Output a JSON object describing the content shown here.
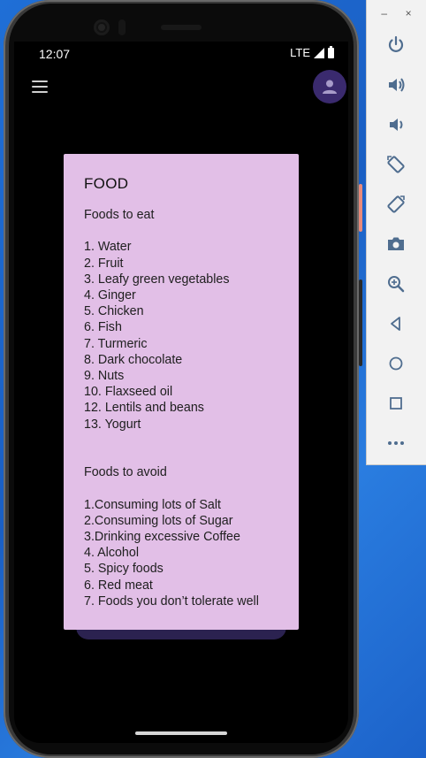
{
  "status_bar": {
    "time": "12:07",
    "network": "LTE"
  },
  "note": {
    "title": "FOOD",
    "lines": [
      "Foods to eat",
      "",
      "1. Water",
      "2. Fruit",
      "3. Leafy green vegetables",
      "4. Ginger",
      "5. Chicken",
      "6. Fish",
      "7. Turmeric",
      "8. Dark chocolate",
      "9. Nuts",
      "10. Flaxseed oil",
      "12. Lentils and beans",
      "13. Yogurt",
      "",
      "",
      "Foods to avoid",
      "",
      "1.Consuming lots of Salt",
      "2.Consuming lots of Sugar",
      "3.Drinking excessive Coffee",
      "4. Alcohol",
      "5. Spicy foods",
      "6. Red meat",
      "7. Foods you don’t tolerate well"
    ]
  },
  "emulator_toolbar": {
    "window_controls": [
      "–",
      "×"
    ],
    "buttons": [
      "power-icon",
      "volume-up-icon",
      "volume-down-icon",
      "rotate-left-icon",
      "rotate-right-icon",
      "camera-icon",
      "zoom-icon",
      "back-icon",
      "home-icon",
      "overview-icon",
      "more-icon"
    ]
  },
  "colors": {
    "card": "#e2bfe7",
    "avatar": "#3a2a6e",
    "desktop": "#1f6fd6"
  }
}
